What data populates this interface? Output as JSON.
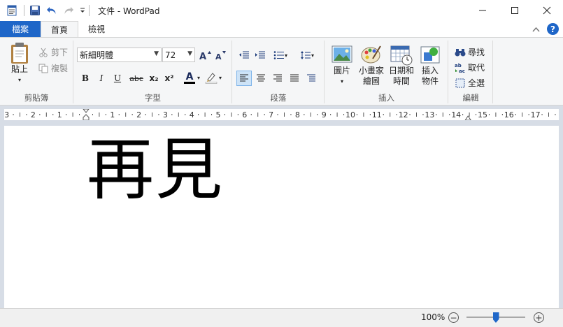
{
  "window": {
    "title": "文件 - WordPad",
    "controls": {
      "minimize": "—",
      "maximize": "☐",
      "close": "✕"
    }
  },
  "tabs": {
    "file": "檔案",
    "home": "首頁",
    "view": "檢視"
  },
  "clipboard": {
    "paste": "貼上",
    "cut": "剪下",
    "copy": "複製",
    "label": "剪貼簿"
  },
  "font": {
    "family": "新細明體",
    "size": "72",
    "label": "字型",
    "bold": "B",
    "italic": "I",
    "underline": "U",
    "strike": "abc",
    "subscript": "x₂",
    "superscript": "x²",
    "color_glyph": "A"
  },
  "paragraph": {
    "label": "段落"
  },
  "insert": {
    "picture": "圖片",
    "paint_l1": "小畫家",
    "paint_l2": "繪圖",
    "datetime_l1": "日期和",
    "datetime_l2": "時間",
    "object_l1": "插入",
    "object_l2": "物件",
    "label": "插入"
  },
  "editing": {
    "find": "尋找",
    "replace": "取代",
    "select_all": "全選",
    "label": "編輯"
  },
  "ruler": {
    "labels": [
      "3",
      "2",
      "1",
      "1",
      "2",
      "3",
      "4",
      "5",
      "6",
      "7",
      "8",
      "9",
      "10",
      "11",
      "12",
      "13",
      "14",
      "15",
      "16",
      "17"
    ]
  },
  "document": {
    "text": "再見"
  },
  "status": {
    "zoom": "100%",
    "zoom_level": 0.5
  },
  "colors": {
    "accent": "#1e66c8",
    "ribbon_bg": "#f5f6f7",
    "font_color_bar": "#000000",
    "highlight_bar": "#ffffff"
  }
}
